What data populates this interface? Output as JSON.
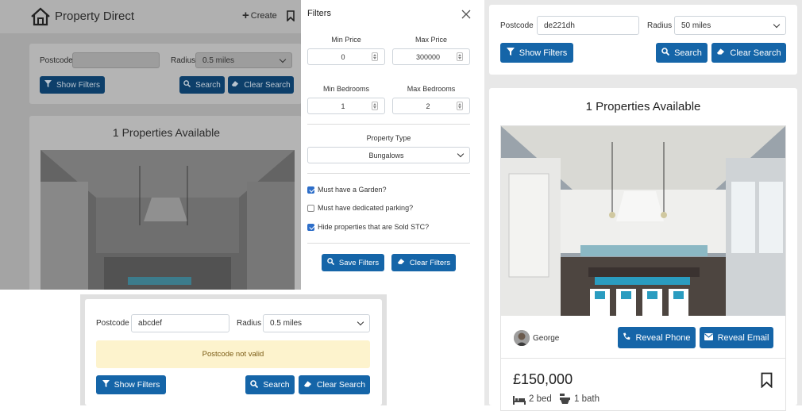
{
  "app": {
    "title": "Property Direct",
    "create_label": "Create"
  },
  "search": {
    "postcode_label": "Postcode",
    "radius_label": "Radius",
    "show_filters": "Show Filters",
    "search": "Search",
    "clear_search": "Clear Search"
  },
  "left_panel": {
    "postcode_value": "",
    "radius_value": "0.5 miles",
    "results_title": "1 Properties Available"
  },
  "filters": {
    "title": "Filters",
    "min_price_label": "Min Price",
    "min_price_value": "0",
    "max_price_label": "Max Price",
    "max_price_value": "300000",
    "min_bed_label": "Min Bedrooms",
    "min_bed_value": "1",
    "max_bed_label": "Max Bedrooms",
    "max_bed_value": "2",
    "property_type_label": "Property Type",
    "property_type_value": "Bungalows",
    "checkboxes": [
      {
        "label": "Must have a Garden?",
        "checked": true
      },
      {
        "label": "Must have dedicated parking?",
        "checked": false
      },
      {
        "label": "Hide properties that are Sold STC?",
        "checked": true
      }
    ],
    "save_filters": "Save Filters",
    "clear_filters": "Clear Filters"
  },
  "error_panel": {
    "postcode_value": "abcdef",
    "radius_value": "0.5 miles",
    "error_message": "Postcode not valid"
  },
  "right_panel": {
    "postcode_value": "de221dh",
    "radius_value": "50 miles",
    "results_title": "1 Properties Available",
    "agent_name": "George",
    "reveal_phone": "Reveal Phone",
    "reveal_email": "Reveal Email",
    "price": "£150,000",
    "beds": "2 bed",
    "baths": "1 bath"
  },
  "colors": {
    "primary": "#1565a8",
    "alert_bg": "#fdf3cd",
    "overlay_bg": "#a9a9a9"
  }
}
